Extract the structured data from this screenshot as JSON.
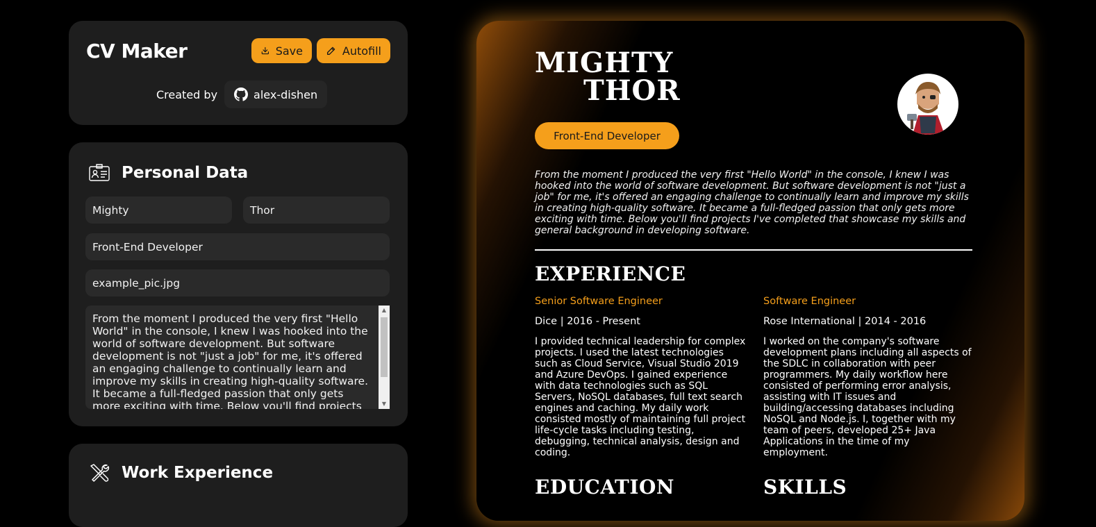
{
  "header": {
    "app_title": "CV Maker",
    "save_label": "Save",
    "autofill_label": "Autofill",
    "created_by_label": "Created by",
    "github_user": "alex-dishen"
  },
  "personal": {
    "section_title": "Personal Data",
    "first_name": "Mighty",
    "last_name": "Thor",
    "job_title": "Front-End Developer",
    "picture": "example_pic.jpg",
    "about": "From the moment I produced the very first \"Hello World\" in the console, I knew I was hooked into the world of software development. But software development is not \"just a job\" for me, it's offered an engaging challenge to continually learn and improve my skills in creating high-quality software.  It  became a full-fledged passion that only gets more exciting with time. Below you'll find projects I've completed"
  },
  "work": {
    "section_title": "Work Experience"
  },
  "cv": {
    "first_name": "MIGHTY",
    "last_name": "THOR",
    "role": "Front-End Developer",
    "summary": "From the moment I produced the very first \"Hello World\" in the console, I knew I was hooked into the world of software development. But software development is not \"just a job\" for me, it's offered an engaging challenge to continually learn and improve my skills in creating high-quality software. It became a full-fledged passion that only gets more exciting with time. Below you'll find projects I've completed that showcase my skills and general background in developing software.",
    "experience_heading": "EXPERIENCE",
    "education_heading": "EDUCATION",
    "skills_heading": "SKILLS",
    "jobs": [
      {
        "title": "Senior Software Engineer",
        "meta": "Dice | 2016 - Present",
        "desc": "I provided technical leadership for complex projects. I used the latest technologies such as Cloud Service, Visual Studio 2019 and Azure DevOps. I gained experience with data technologies such as SQL Servers, NoSQL databases, full text search engines and caching. My daily work consisted mostly of maintaining full project life-cycle tasks including testing, debugging, technical analysis, design and coding."
      },
      {
        "title": "Software Engineer",
        "meta": "Rose International | 2014 - 2016",
        "desc": "I worked on the company's software development plans including all aspects of the SDLC in collaboration with peer programmers. My daily workflow here consisted of performing error analysis, assisting with IT issues and building/accessing databases including NoSQL and Node.js. I, together with my team of peers, developed 25+ Java Applications in the time of my employment."
      }
    ]
  },
  "colors": {
    "accent": "#f59f1b",
    "card": "#1e1e1e",
    "field": "#2a2a2a",
    "background": "#000000"
  },
  "icons": {
    "save": "download-icon",
    "autofill": "pencil-icon",
    "github": "github-icon",
    "personal": "id-card-icon",
    "work": "tools-icon"
  }
}
